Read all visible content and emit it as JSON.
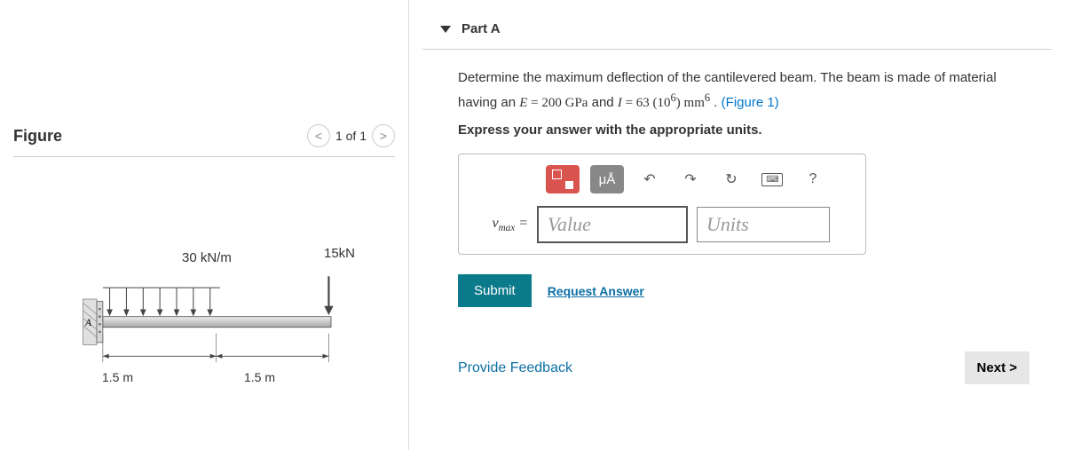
{
  "figure": {
    "title": "Figure",
    "pager": "1 of 1",
    "dist_load": "30 kN/m",
    "point_load": "15kN",
    "dim_left": "1.5 m",
    "dim_right": "1.5 m",
    "node_label": "A"
  },
  "part": {
    "title": "Part A",
    "text_prefix": "Determine the maximum deflection of the cantilevered beam. The beam is made of material having an ",
    "eq1_var": "E",
    "eq1_val": " = 200 GPa",
    "text_mid": " and ",
    "eq2_var": "I",
    "eq2_val": " = 63 (10",
    "eq2_sup": "6",
    "eq2_unit": ") mm",
    "eq2_usup": "6",
    "text_end": " . ",
    "figure_ref": "(Figure 1)",
    "instruction": "Express your answer with the appropriate units."
  },
  "toolbar": {
    "format": "μÅ",
    "help": "?"
  },
  "input": {
    "var_label": "vₘₐₓ =",
    "value_placeholder": "Value",
    "units_placeholder": "Units"
  },
  "actions": {
    "submit": "Submit",
    "request": "Request Answer"
  },
  "footer": {
    "feedback": "Provide Feedback",
    "next": "Next >"
  }
}
